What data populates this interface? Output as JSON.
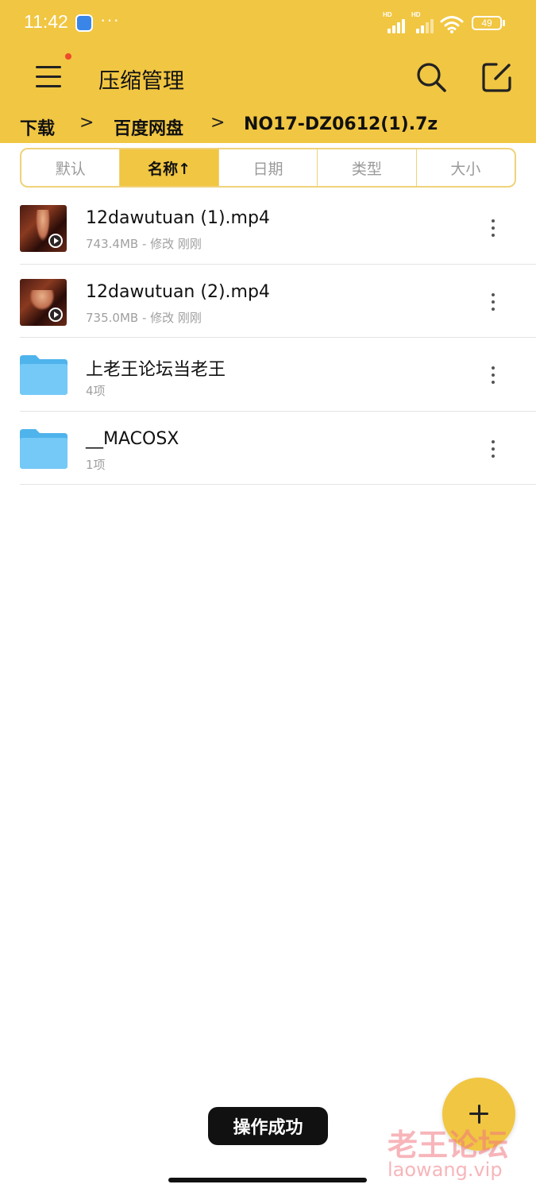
{
  "status_bar": {
    "time": "11:42",
    "dots": "···",
    "signal_label": "HD",
    "battery": "49",
    "icons": [
      "app-notification-icon",
      "signal-icon",
      "signal-icon",
      "wifi-icon",
      "battery-icon"
    ]
  },
  "header": {
    "title": "压缩管理",
    "icons": [
      "menu-icon",
      "search-icon",
      "edit-icon"
    ],
    "notification_dot_color": "#ee4a2b",
    "background_color": "#f1c642"
  },
  "breadcrumb": {
    "items": [
      "下载",
      "百度网盘",
      "NO17-DZ0612(1).7z"
    ],
    "separator": ">"
  },
  "sort_tabs": {
    "items": [
      {
        "label": "默认",
        "active": false
      },
      {
        "label": "名称↑",
        "active": true
      },
      {
        "label": "日期",
        "active": false
      },
      {
        "label": "类型",
        "active": false
      },
      {
        "label": "大小",
        "active": false
      }
    ]
  },
  "files": [
    {
      "name": "12dawutuan (1).mp4",
      "meta": "743.4MB - 修改 刚刚",
      "kind": "video"
    },
    {
      "name": "12dawutuan (2).mp4",
      "meta": "735.0MB - 修改 刚刚",
      "kind": "video"
    },
    {
      "name": "上老王论坛当老王",
      "meta": "4项",
      "kind": "folder"
    },
    {
      "name": "__MACOSX",
      "meta": "1项",
      "kind": "folder"
    }
  ],
  "toast": {
    "text": "操作成功"
  },
  "fab": {
    "icon": "plus-icon"
  },
  "watermark": {
    "title": "老王论坛",
    "url": "laowang.vip"
  }
}
